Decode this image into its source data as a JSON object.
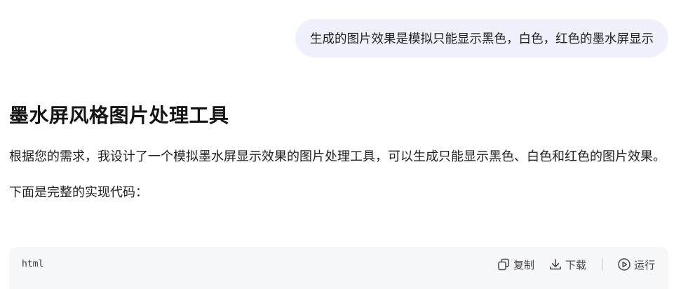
{
  "user_message": {
    "text": "生成的图片效果是模拟只能显示黑色，白色，红色的墨水屏显示"
  },
  "answer": {
    "title": "墨水屏风格图片处理工具",
    "intro": "根据您的需求，我设计了一个模拟墨水屏显示效果的图片处理工具，可以生成只能显示黑色、白色和红色的图片效果。",
    "lead": "下面是完整的实现代码："
  },
  "code_block": {
    "language": "html",
    "actions": {
      "copy": {
        "label": "复制",
        "icon": "copy-icon"
      },
      "download": {
        "label": "下载",
        "icon": "download-icon"
      },
      "run": {
        "label": "运行",
        "icon": "play-circle-icon"
      }
    }
  },
  "colors": {
    "user_bubble_bg": "#eef1fb",
    "code_block_bg": "#f6f7f9",
    "text": "#1f1f1f"
  }
}
